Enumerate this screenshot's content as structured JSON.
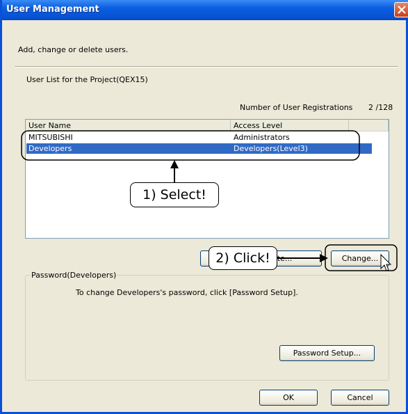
{
  "window": {
    "title": "User Management",
    "close_icon": "close-icon"
  },
  "intro_text": "Add, change or delete users.",
  "user_list_label": "User List for the Project(QEX15)",
  "registrations": {
    "label": "Number of User Registrations",
    "value": "2 /128"
  },
  "list": {
    "columns": [
      "User Name",
      "Access Level"
    ],
    "rows": [
      {
        "user_name": "MITSUBISHI",
        "access_level": "Administrators",
        "selected": false
      },
      {
        "user_name": "Developers",
        "access_level": "Developers(Level3)",
        "selected": true
      }
    ]
  },
  "buttons": {
    "delete_label_fragment": "ete...",
    "change_label": "Change...",
    "password_setup_label": "Password Setup...",
    "ok_label": "OK",
    "cancel_label": "Cancel"
  },
  "password_group": {
    "label": "Password(Developers)",
    "instruction": "To change Developers's password, click [Password Setup]."
  },
  "annotations": {
    "select_callout": "1) Select!",
    "click_callout": "2) Click!"
  },
  "colors": {
    "title_bar": "#0a5ee0",
    "selection": "#316ac5",
    "dialog_bg": "#ece9d8"
  }
}
